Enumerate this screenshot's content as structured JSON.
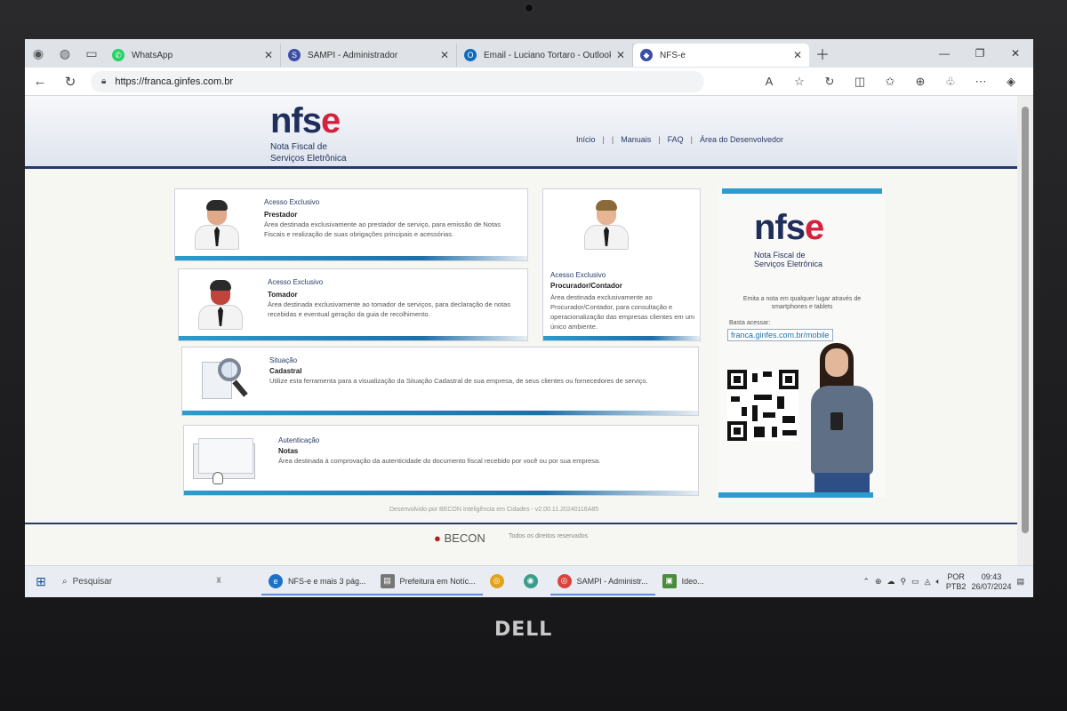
{
  "browser": {
    "tabs": [
      {
        "label": "WhatsApp",
        "icon": "whatsapp-icon",
        "color": "#25d366"
      },
      {
        "label": "SAMPI - Administrador",
        "icon": "sampi-icon",
        "color": "#3b4ea8"
      },
      {
        "label": "Email - Luciano Tortaro - Outlook",
        "icon": "outlook-icon",
        "color": "#0f6cbd"
      },
      {
        "label": "NFS-e",
        "icon": "nfse-icon",
        "color": "#3b4ea8"
      }
    ],
    "url": "https://franca.ginfes.com.br"
  },
  "header": {
    "logo_prefix": "nfs",
    "logo_suffix": "e",
    "logo_sub1": "Nota Fiscal de",
    "logo_sub2": "Serviços Eletrônica",
    "nav": [
      "Início",
      "Manuais",
      "FAQ",
      "Área do Desenvolvedor"
    ]
  },
  "cards": {
    "prestador": {
      "title": "Acesso Exclusivo",
      "bold": "Prestador",
      "desc": "Área destinada exclusivamente ao prestador de serviço, para emissão de Notas Fiscais e realização de suas obrigações principais e acessórias."
    },
    "tomador": {
      "title": "Acesso Exclusivo",
      "bold": "Tomador",
      "desc": "Área destinada exclusivamente ao tomador de serviços, para declaração de notas recebidas e eventual geração da guia de recolhimento."
    },
    "procurador": {
      "title": "Acesso Exclusivo",
      "bold": "Procurador/Contador",
      "desc": "Área destinada exclusivamente ao Procurador/Contador, para consultação e operacionalização das empresas clientes em um único ambiente."
    },
    "situacao": {
      "title": "Situação",
      "bold": "Cadastral",
      "desc": "Utilize esta ferramenta para a visualização da Situação Cadastral de sua empresa, de seus clientes ou fornecedores de serviço."
    },
    "autenticacao": {
      "title": "Autenticação",
      "bold": "Notas",
      "desc": "Área destinada à comprovação da autenticidade do documento fiscal recebido por você ou por sua empresa."
    }
  },
  "promo": {
    "logo_prefix": "nfs",
    "logo_suffix": "e",
    "sub1": "Nota Fiscal de",
    "sub2": "Serviços Eletrônica",
    "text": "Emita a nota em qualquer lugar através de smartphones e tablets",
    "acessar": "Basta acessar:",
    "url": "franca.ginfes.com.br/mobile"
  },
  "footer": {
    "developed": "Desenvolvido por BECON Inteligência em Cidades - v2.00.11.20240116A85",
    "logo": "BECON",
    "rights": "Todos os direitos reservados"
  },
  "taskbar": {
    "search": "Pesquisar",
    "apps": [
      {
        "label": "NFS-e e mais 3 pág...",
        "icon": "edge-icon",
        "color": "#1a73c9"
      },
      {
        "label": "Prefeitura em Notíc...",
        "icon": "document-icon",
        "color": "#777777"
      },
      {
        "label": "",
        "icon": "chrome-icon",
        "color": "#e2a21b"
      },
      {
        "label": "",
        "icon": "app-icon",
        "color": "#3a9d8a"
      },
      {
        "label": "SAMPI - Administr...",
        "icon": "chrome-icon",
        "color": "#d9443a"
      },
      {
        "label": "Ideo...",
        "icon": "app-icon",
        "color": "#4a8b3c"
      }
    ],
    "lang1": "POR",
    "lang2": "PTB2",
    "time": "09:43",
    "date": "26/07/2024"
  },
  "device": {
    "brand": "DELL"
  }
}
